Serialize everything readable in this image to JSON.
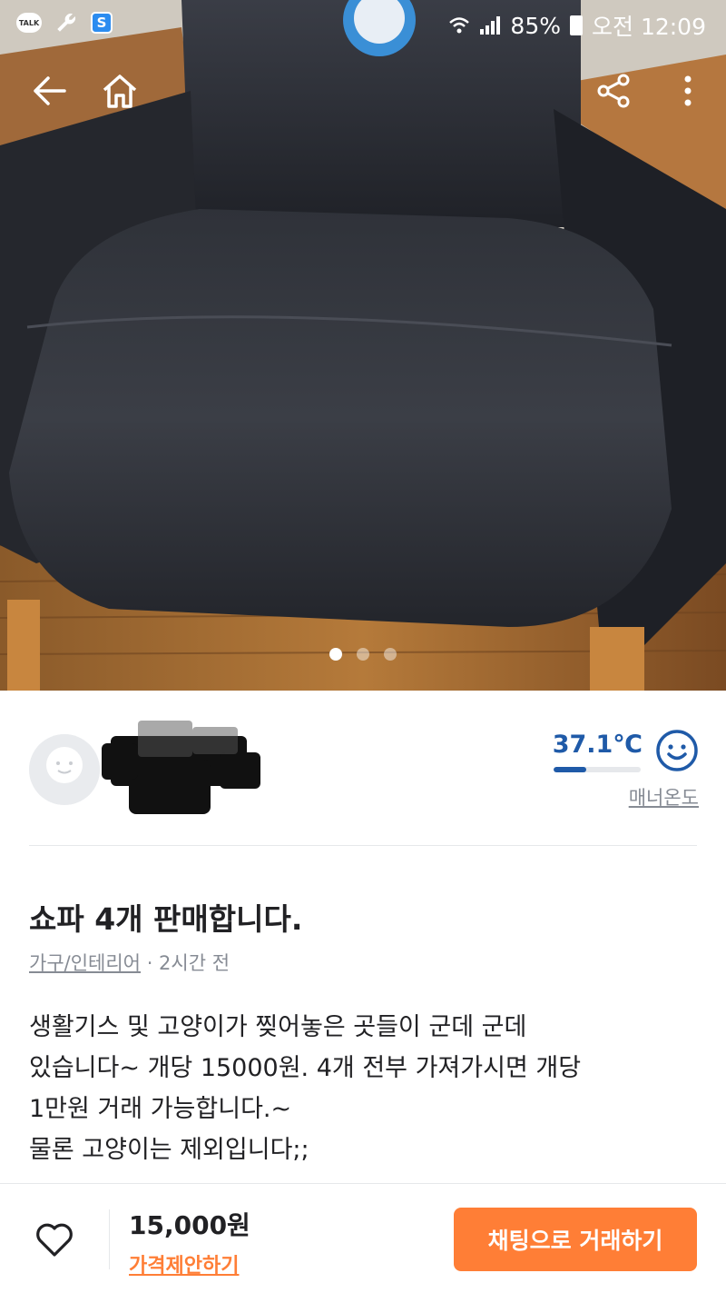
{
  "status_bar": {
    "battery": "85%",
    "time": "오전 12:09",
    "left_app_icons": [
      "talk-icon",
      "wrench-icon",
      "s-app-icon"
    ],
    "talk_label": "TALK",
    "s_app_label": "S"
  },
  "nav": {
    "icons": [
      "back-arrow-icon",
      "home-icon",
      "share-icon",
      "more-vertical-icon"
    ]
  },
  "carousel": {
    "count": 3,
    "active_index": 0
  },
  "seller": {
    "manner_temperature": "37.1℃",
    "manner_temperature_level": 0.371,
    "manner_label": "매너온도",
    "accent_color": "#1f5aa8"
  },
  "article": {
    "title": "쇼파 4개 판매합니다.",
    "category": "가구/인테리어",
    "time_ago": "· 2시간 전",
    "body_lines": [
      "생활기스 및 고양이가 찢어놓은 곳들이 군데 군데",
      "있습니다~ 개당 15000원. 4개 전부 가져가시면 개당",
      "1만원 거래 가능합니다.~",
      "물론 고양이는 제외입니다;;"
    ]
  },
  "bottom": {
    "price": "15,000원",
    "offer_label": "가격제안하기",
    "chat_button": "채팅으로 거래하기",
    "accent_color": "#ff7e36"
  }
}
